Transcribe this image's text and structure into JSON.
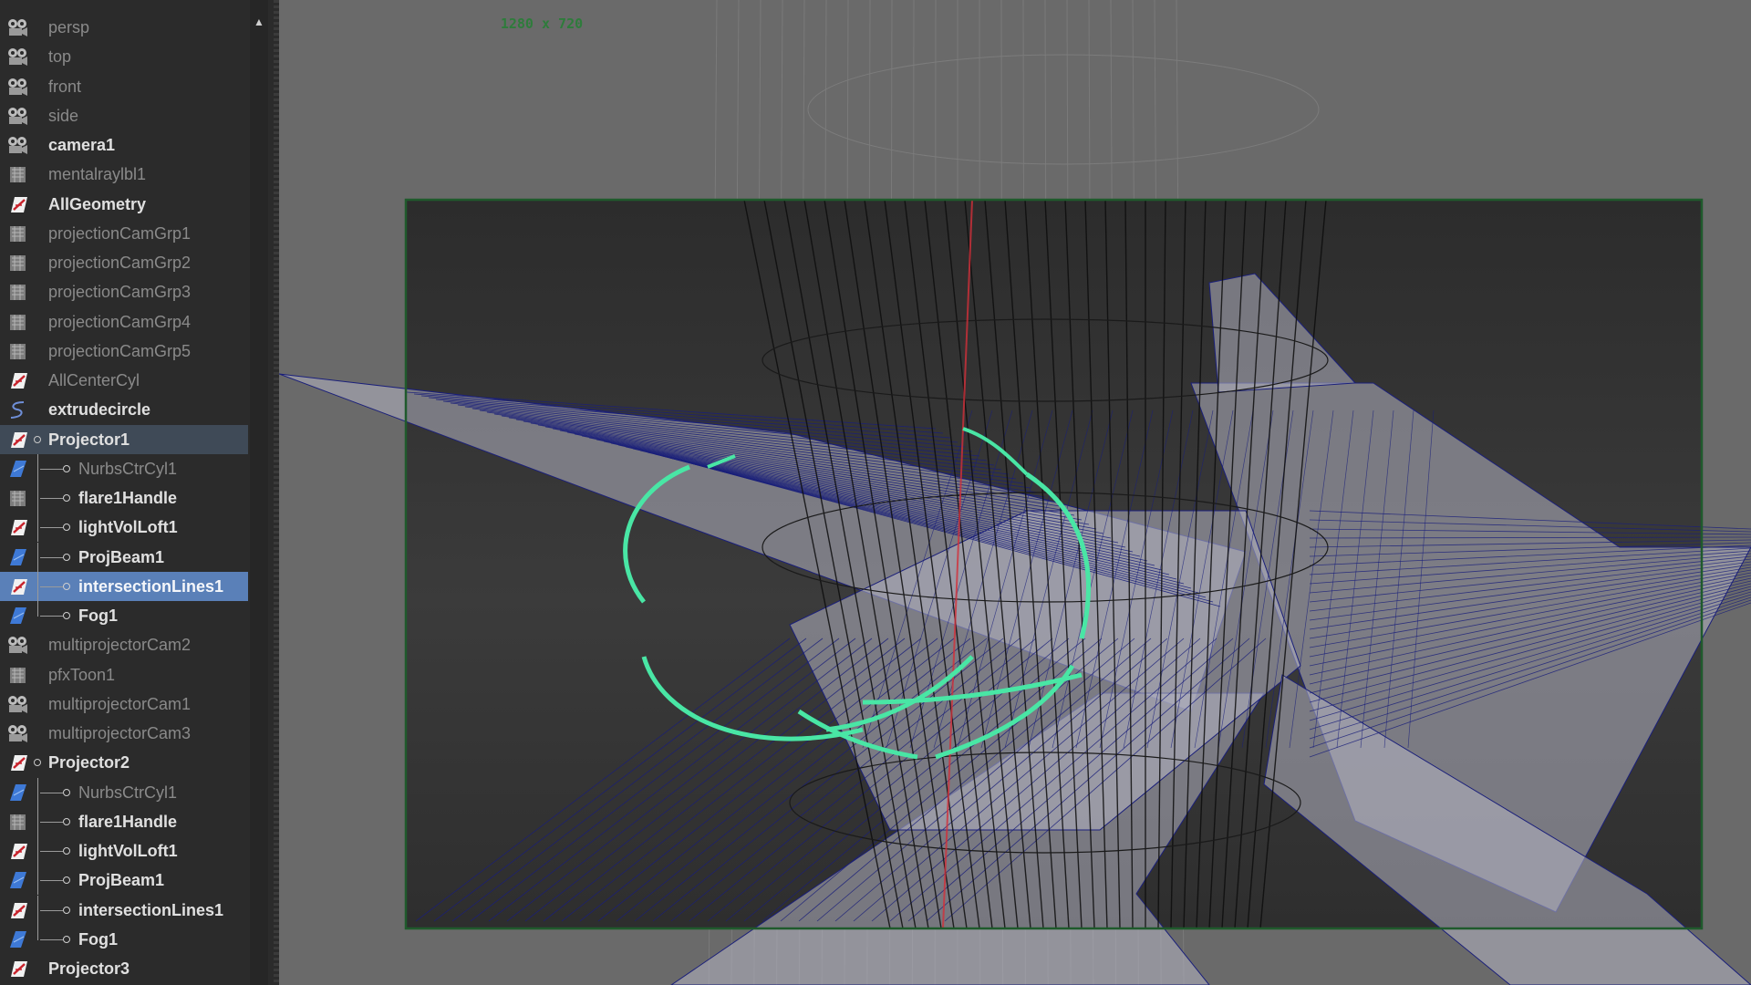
{
  "outliner": {
    "items": [
      {
        "label": "persp",
        "icon": "camera-icon",
        "bold": false
      },
      {
        "label": "top",
        "icon": "camera-icon",
        "bold": false
      },
      {
        "label": "front",
        "icon": "camera-icon",
        "bold": false
      },
      {
        "label": "side",
        "icon": "camera-icon",
        "bold": false
      },
      {
        "label": "camera1",
        "icon": "camera-icon",
        "bold": true
      },
      {
        "label": "mentalraylbl1",
        "icon": "transform-icon",
        "bold": false
      },
      {
        "label": "AllGeometry",
        "icon": "group-icon",
        "bold": true
      },
      {
        "label": "projectionCamGrp1",
        "icon": "transform-icon",
        "bold": false
      },
      {
        "label": "projectionCamGrp2",
        "icon": "transform-icon",
        "bold": false
      },
      {
        "label": "projectionCamGrp3",
        "icon": "transform-icon",
        "bold": false
      },
      {
        "label": "projectionCamGrp4",
        "icon": "transform-icon",
        "bold": false
      },
      {
        "label": "projectionCamGrp5",
        "icon": "transform-icon",
        "bold": false
      },
      {
        "label": "AllCenterCyl",
        "icon": "group-icon",
        "bold": false
      },
      {
        "label": "extrudecircle",
        "icon": "curve-icon",
        "bold": true
      },
      {
        "label": "Projector1",
        "icon": "group-icon",
        "bold": true,
        "expanded": true,
        "state": "parent-of-selected"
      },
      {
        "label": "NurbsCtrCyl1",
        "icon": "nurbs-surface-icon",
        "bold": false,
        "child": true
      },
      {
        "label": "flare1Handle",
        "icon": "transform-icon",
        "bold": true,
        "child": true
      },
      {
        "label": "lightVolLoft1",
        "icon": "group-icon",
        "bold": true,
        "child": true
      },
      {
        "label": "ProjBeam1",
        "icon": "nurbs-surface-icon",
        "bold": true,
        "child": true
      },
      {
        "label": "intersectionLines1",
        "icon": "group-icon",
        "bold": true,
        "child": true,
        "state": "selected"
      },
      {
        "label": "Fog1",
        "icon": "nurbs-surface-icon",
        "bold": true,
        "child": true,
        "last": true
      },
      {
        "label": "multiprojectorCam2",
        "icon": "camera-icon",
        "bold": false
      },
      {
        "label": "pfxToon1",
        "icon": "transform-icon",
        "bold": false
      },
      {
        "label": "multiprojectorCam1",
        "icon": "camera-icon",
        "bold": false
      },
      {
        "label": "multiprojectorCam3",
        "icon": "camera-icon",
        "bold": false
      },
      {
        "label": "Projector2",
        "icon": "group-icon",
        "bold": true,
        "expanded": true
      },
      {
        "label": "NurbsCtrCyl1",
        "icon": "nurbs-surface-icon",
        "bold": false,
        "child": true
      },
      {
        "label": "flare1Handle",
        "icon": "transform-icon",
        "bold": true,
        "child": true
      },
      {
        "label": "lightVolLoft1",
        "icon": "group-icon",
        "bold": true,
        "child": true
      },
      {
        "label": "ProjBeam1",
        "icon": "nurbs-surface-icon",
        "bold": true,
        "child": true
      },
      {
        "label": "intersectionLines1",
        "icon": "group-icon",
        "bold": true,
        "child": true
      },
      {
        "label": "Fog1",
        "icon": "nurbs-surface-icon",
        "bold": true,
        "child": true,
        "last": true
      },
      {
        "label": "Projector3",
        "icon": "group-icon",
        "bold": true
      }
    ]
  },
  "viewport": {
    "resolution_gate": "1280 x 720",
    "colors": {
      "gate_border": "#1f5a2c",
      "wireframe": "#1a1f7a",
      "selected_curve": "#49e6a5",
      "axis": "#d2303a"
    }
  }
}
